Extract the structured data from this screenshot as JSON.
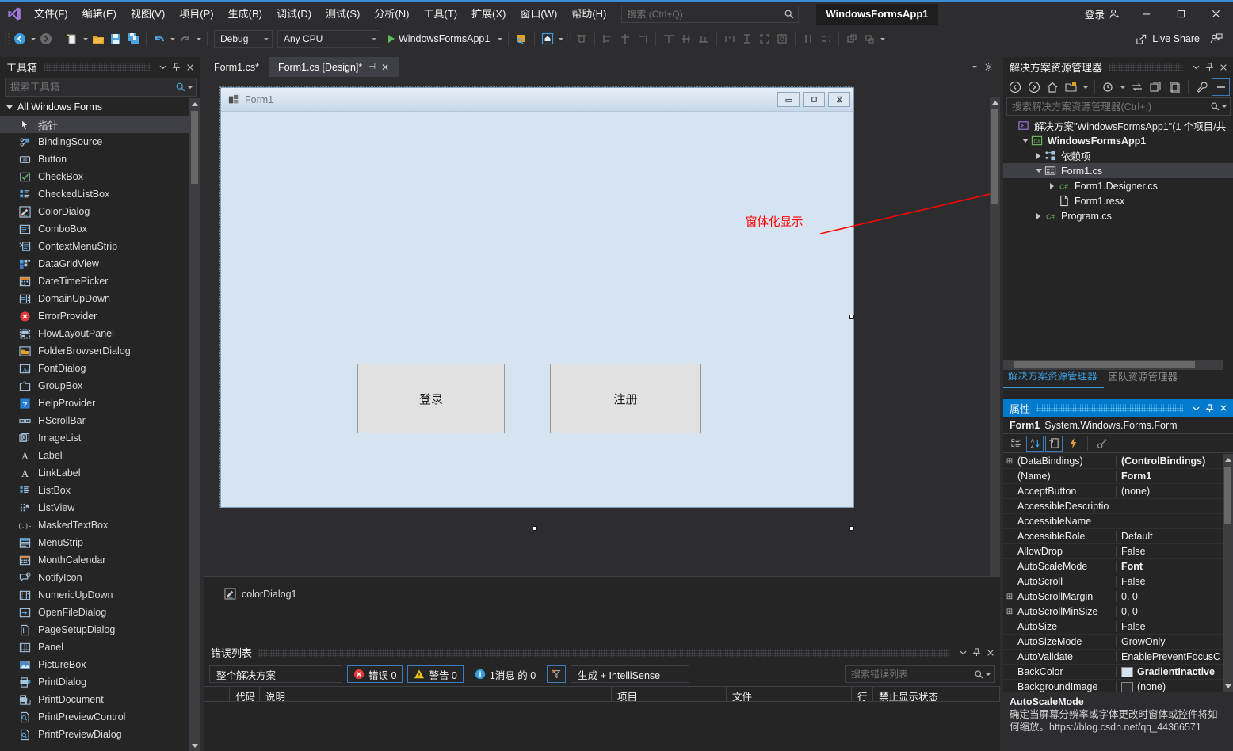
{
  "titlebar": {
    "menus": [
      "文件(F)",
      "编辑(E)",
      "视图(V)",
      "项目(P)",
      "生成(B)",
      "调试(D)",
      "测试(S)",
      "分析(N)",
      "工具(T)",
      "扩展(X)",
      "窗口(W)",
      "帮助(H)"
    ],
    "search_placeholder": "搜索 (Ctrl+Q)",
    "project_chip": "WindowsFormsApp1",
    "signin_label": "登录"
  },
  "toolbar": {
    "config": "Debug",
    "platform": "Any CPU",
    "run_target": "WindowsFormsApp1",
    "live_share": "Live Share"
  },
  "toolbox": {
    "title": "工具箱",
    "search_placeholder": "搜索工具箱",
    "group": "All Windows Forms",
    "items": [
      {
        "label": "指针",
        "icon": "pointer-icon",
        "selected": true
      },
      {
        "label": "BindingSource",
        "icon": "bindingsource-icon"
      },
      {
        "label": "Button",
        "icon": "button-icon"
      },
      {
        "label": "CheckBox",
        "icon": "checkbox-icon"
      },
      {
        "label": "CheckedListBox",
        "icon": "checkedlistbox-icon"
      },
      {
        "label": "ColorDialog",
        "icon": "colordialog-icon"
      },
      {
        "label": "ComboBox",
        "icon": "combobox-icon"
      },
      {
        "label": "ContextMenuStrip",
        "icon": "contextmenustrip-icon"
      },
      {
        "label": "DataGridView",
        "icon": "datagridview-icon"
      },
      {
        "label": "DateTimePicker",
        "icon": "datetimepicker-icon"
      },
      {
        "label": "DomainUpDown",
        "icon": "domainupdown-icon"
      },
      {
        "label": "ErrorProvider",
        "icon": "errorprovider-icon"
      },
      {
        "label": "FlowLayoutPanel",
        "icon": "flowlayoutpanel-icon"
      },
      {
        "label": "FolderBrowserDialog",
        "icon": "folderbrowserdialog-icon"
      },
      {
        "label": "FontDialog",
        "icon": "fontdialog-icon"
      },
      {
        "label": "GroupBox",
        "icon": "groupbox-icon"
      },
      {
        "label": "HelpProvider",
        "icon": "helpprovider-icon"
      },
      {
        "label": "HScrollBar",
        "icon": "hscrollbar-icon"
      },
      {
        "label": "ImageList",
        "icon": "imagelist-icon"
      },
      {
        "label": "Label",
        "icon": "label-icon"
      },
      {
        "label": "LinkLabel",
        "icon": "linklabel-icon"
      },
      {
        "label": "ListBox",
        "icon": "listbox-icon"
      },
      {
        "label": "ListView",
        "icon": "listview-icon"
      },
      {
        "label": "MaskedTextBox",
        "icon": "maskedtextbox-icon"
      },
      {
        "label": "MenuStrip",
        "icon": "menustrip-icon"
      },
      {
        "label": "MonthCalendar",
        "icon": "monthcalendar-icon"
      },
      {
        "label": "NotifyIcon",
        "icon": "notifyicon-icon"
      },
      {
        "label": "NumericUpDown",
        "icon": "numericupdown-icon"
      },
      {
        "label": "OpenFileDialog",
        "icon": "openfiledialog-icon"
      },
      {
        "label": "PageSetupDialog",
        "icon": "pagesetupdialog-icon"
      },
      {
        "label": "Panel",
        "icon": "panel-icon"
      },
      {
        "label": "PictureBox",
        "icon": "picturebox-icon"
      },
      {
        "label": "PrintDialog",
        "icon": "printdialog-icon"
      },
      {
        "label": "PrintDocument",
        "icon": "printdocument-icon"
      },
      {
        "label": "PrintPreviewControl",
        "icon": "printpreviewcontrol-icon"
      },
      {
        "label": "PrintPreviewDialog",
        "icon": "printpreviewdialog-icon"
      }
    ]
  },
  "editor": {
    "tabs": [
      {
        "label": "Form1.cs*",
        "active": false
      },
      {
        "label": "Form1.cs [Design]*",
        "active": true
      }
    ]
  },
  "designer": {
    "form_title": "Form1",
    "buttons": [
      {
        "label": "登录"
      },
      {
        "label": "注册"
      }
    ],
    "annotation": "窗体化显示",
    "tray_component": "colorDialog1"
  },
  "errorlist": {
    "title": "错误列表",
    "scope": "整个解决方案",
    "errors": "错误 0",
    "warnings": "警告 0",
    "messages": "1消息 的 0",
    "build_filter": "生成 + IntelliSense",
    "search_placeholder": "搜索错误列表",
    "columns": [
      "代码",
      "说明",
      "项目",
      "文件",
      "行",
      "禁止显示状态"
    ]
  },
  "solution_explorer": {
    "title": "解决方案资源管理器",
    "search_placeholder": "搜索解决方案资源管理器(Ctrl+;)",
    "tree": [
      {
        "label": "解决方案\"WindowsFormsApp1\"(1 个项目/共",
        "indent": 0,
        "icon": "solution-icon",
        "expander": "none",
        "bold": false
      },
      {
        "label": "WindowsFormsApp1",
        "indent": 1,
        "icon": "csproj-icon",
        "expander": "open",
        "bold": true
      },
      {
        "label": "依赖项",
        "indent": 2,
        "icon": "dependencies-icon",
        "expander": "closed",
        "bold": false
      },
      {
        "label": "Form1.cs",
        "indent": 2,
        "icon": "form-icon",
        "expander": "open",
        "bold": false,
        "selected": true
      },
      {
        "label": "Form1.Designer.cs",
        "indent": 3,
        "icon": "cs-icon",
        "expander": "closed",
        "bold": false
      },
      {
        "label": "Form1.resx",
        "indent": 3,
        "icon": "resx-icon",
        "expander": "none",
        "bold": false
      },
      {
        "label": "Program.cs",
        "indent": 2,
        "icon": "cs-icon",
        "expander": "closed",
        "bold": false
      }
    ],
    "tabs": [
      {
        "label": "解决方案资源管理器",
        "active": true
      },
      {
        "label": "团队资源管理器",
        "active": false
      }
    ]
  },
  "properties": {
    "title": "属性",
    "object_name": "Form1",
    "object_type": "System.Windows.Forms.Form",
    "rows": [
      {
        "expander": true,
        "name": "(DataBindings)",
        "value": "(ControlBindings)",
        "bold": true
      },
      {
        "expander": false,
        "name": "(Name)",
        "value": "Form1",
        "bold": true
      },
      {
        "expander": false,
        "name": "AcceptButton",
        "value": "(none)",
        "bold": false
      },
      {
        "expander": false,
        "name": "AccessibleDescriptio",
        "value": "",
        "bold": false
      },
      {
        "expander": false,
        "name": "AccessibleName",
        "value": "",
        "bold": false
      },
      {
        "expander": false,
        "name": "AccessibleRole",
        "value": "Default",
        "bold": false
      },
      {
        "expander": false,
        "name": "AllowDrop",
        "value": "False",
        "bold": false
      },
      {
        "expander": false,
        "name": "AutoScaleMode",
        "value": "Font",
        "bold": true
      },
      {
        "expander": false,
        "name": "AutoScroll",
        "value": "False",
        "bold": false
      },
      {
        "expander": true,
        "name": "AutoScrollMargin",
        "value": "0, 0",
        "bold": false
      },
      {
        "expander": true,
        "name": "AutoScrollMinSize",
        "value": "0, 0",
        "bold": false
      },
      {
        "expander": false,
        "name": "AutoSize",
        "value": "False",
        "bold": false
      },
      {
        "expander": false,
        "name": "AutoSizeMode",
        "value": "GrowOnly",
        "bold": false
      },
      {
        "expander": false,
        "name": "AutoValidate",
        "value": "EnablePreventFocusC",
        "bold": false
      },
      {
        "expander": false,
        "name": "BackColor",
        "value": "GradientInactive",
        "bold": true,
        "swatch": "#d6e3f0"
      },
      {
        "expander": false,
        "name": "BackgroundImage",
        "value": "(none)",
        "bold": false,
        "swatch": "#2d2d30"
      }
    ],
    "description_title": "AutoScaleMode",
    "description_body": "确定当屏幕分辨率或字体更改时窗体或控件将如何缩放。https://blog.csdn.net/qq_44366571"
  },
  "colors": {
    "accent": "#007acc",
    "chrome": "#2d2d30",
    "panel": "#252526",
    "form_bg": "#d6e3f0",
    "annotation_red": "#ff0000"
  }
}
